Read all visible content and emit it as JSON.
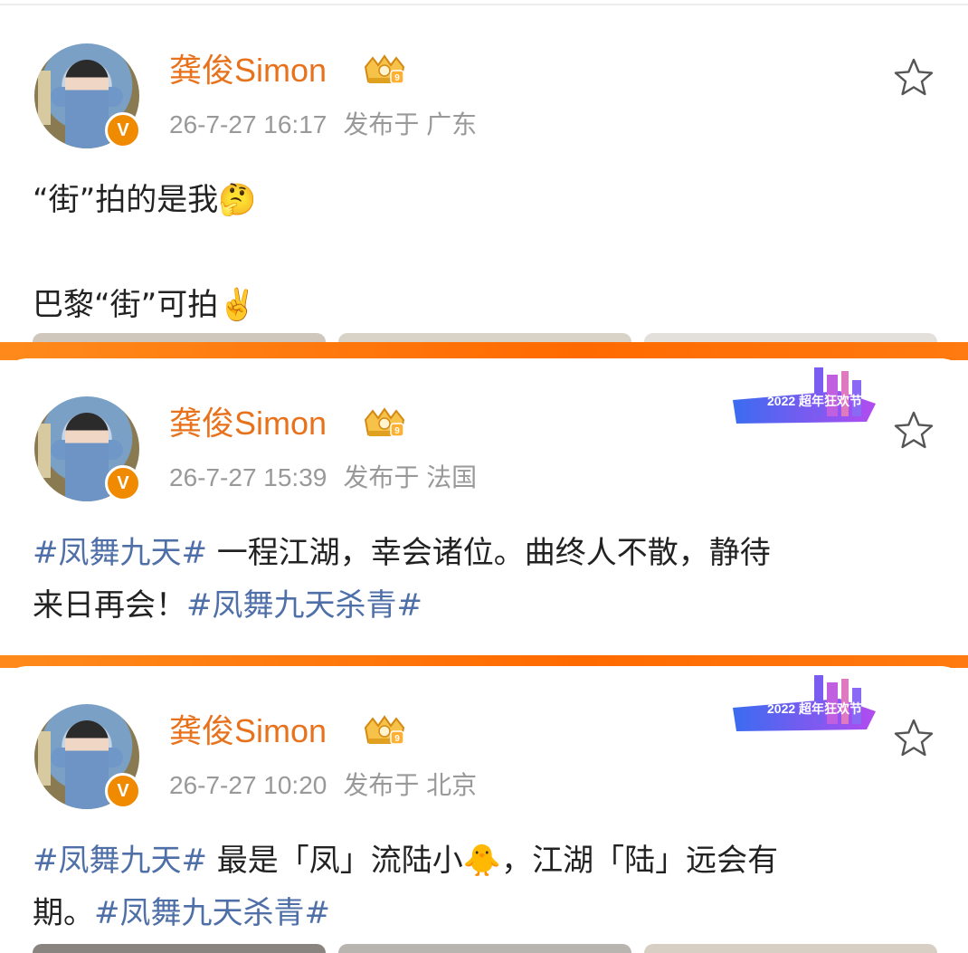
{
  "posts": [
    {
      "username": "龚俊Simon",
      "time": "26-7-27 16:17",
      "location": "发布于 广东",
      "lines": [
        {
          "text": "“街”拍的是我",
          "emoji": "🤔"
        },
        {
          "text": "巴黎“街”可拍",
          "emoji": "✌️"
        }
      ],
      "has_event_badge": false
    },
    {
      "username": "龚俊Simon",
      "time": "26-7-27 15:39",
      "location": "发布于 法国",
      "line1": {
        "tag": "#凤舞九天#",
        "text": " 一程江湖，幸会诸位。曲终人不散，静待"
      },
      "line2": {
        "text": "来日再会！",
        "tag": "#凤舞九天杀青#"
      },
      "event_badge": "2022 超年狂欢节",
      "has_event_badge": true
    },
    {
      "username": "龚俊Simon",
      "time": "26-7-27 10:20",
      "location": "发布于 北京",
      "line1": {
        "tag": "#凤舞九天#",
        "text_a": " 最是「凤」流陆小",
        "emoji": "🐥",
        "text_b": "，江湖「陆」远会有"
      },
      "line2": {
        "text": "期。",
        "tag": "#凤舞九天杀青#"
      },
      "event_badge": "2022 超年狂欢节",
      "has_event_badge": true
    }
  ],
  "colors": {
    "username": "#e8721c",
    "tag": "#4f6fa8",
    "meta": "#999999",
    "divider": "#ff7a10",
    "vip": "#f08a00"
  },
  "icons": {
    "favorite": "star-outline-icon",
    "verified": "verified-v-icon",
    "member": "crown-member-icon"
  }
}
